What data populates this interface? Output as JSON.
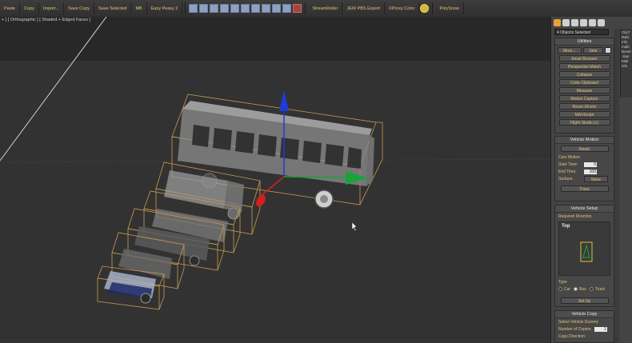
{
  "toolbar": {
    "paste": "Paste",
    "copy": "Copy",
    "import": "Import...",
    "save_copy": "Save Copy",
    "save_selected": "Save Selected",
    "mb": "MB",
    "easy_peasy": "Easy Peasy 2",
    "stream_roller": "StreamRoller",
    "ewpbs_export": "JEW PBS Export",
    "proxy_color": "XProxy Color",
    "poly_snow": "PolySnow"
  },
  "viewport": {
    "label": "+ ] [ Orthographic ] [ Shaded + Edged Faces ]"
  },
  "panel": {
    "objects_selected": "4 Objects Selected",
    "utilities": {
      "title": "Utilities",
      "more": "More...",
      "sets": "Sets",
      "buttons": [
        "Asset Browser",
        "Perspective Match",
        "Collapse",
        "Color Clipboard",
        "Measure",
        "Motion Capture",
        "Reset XForm",
        "MAXScript",
        "Flight Studio (c)"
      ]
    },
    "vehicle_motion": {
      "title": "Vehicle Motion",
      "reset": "Reset",
      "cars_motion": "Cars Motion",
      "start_time_label": "Start Time:",
      "start_time": "0",
      "end_time_label": "End Time:",
      "end_time": "100",
      "surface_label": "Surface:",
      "surface": "None",
      "trace": "Trace"
    },
    "vehicle_setup": {
      "title": "Vehicle Setup",
      "required_direction": "Required Direction",
      "top": "Top",
      "type_label": "Type",
      "types": [
        "Car",
        "Bus",
        "Truck"
      ],
      "set_up": "Set Up"
    },
    "vehicle_copy": {
      "title": "Vehicle Copy",
      "select_dummy": "Select Vehicle Dummy",
      "number_of_copies": "Number of Copies:",
      "copies_value": "1",
      "copy_direction": "Copy Direction:"
    },
    "side_col": [
      "CityT",
      "R&D",
      "Info",
      "malb",
      "Devel",
      "-San",
      "Mail",
      "info"
    ]
  },
  "colors": {
    "accent": "#e6c27a",
    "bbox": "#c99a52",
    "gizmo_blue": "#1f3bd8",
    "gizmo_green": "#1aa23a",
    "gizmo_red": "#d42020"
  }
}
